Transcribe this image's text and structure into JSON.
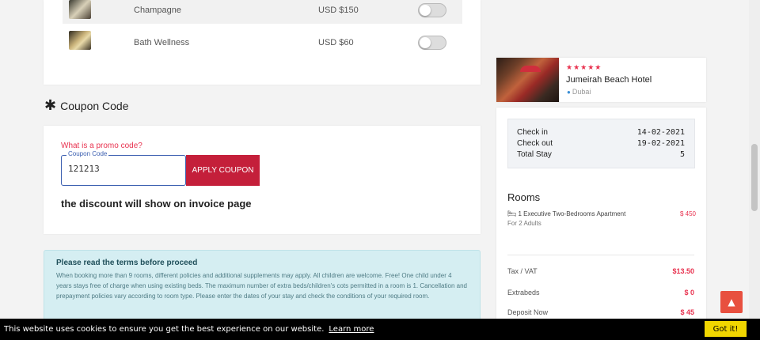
{
  "extras": [
    {
      "name": "Champagne",
      "price": "USD $150"
    },
    {
      "name": "Bath Wellness",
      "price": "USD $60"
    }
  ],
  "coupon": {
    "heading": "Coupon Code",
    "promo_link": "What is a promo code?",
    "field_label": "Coupon Code",
    "field_value": "121213",
    "apply_label": "APPLY COUPON",
    "discount_note": "the discount will show on invoice page"
  },
  "terms": {
    "title": "Please read the terms before proceed",
    "text": "When booking more than 9 rooms, different policies and additional supplements may apply. All children are welcome. Free! One child under 4 years stays free of charge when using existing beds. The maximum number of extra beds/children's cots permitted in a room is 1. Cancellation and prepayment policies vary according to room type. Please enter the dates of your stay and check the conditions of your required room."
  },
  "hotel": {
    "stars": "★★★★★",
    "name": "Jumeirah Beach Hotel",
    "location": "Dubai"
  },
  "stay": {
    "checkin_label": "Check in",
    "checkin_value": "14-02-2021",
    "checkout_label": "Check out",
    "checkout_value": "19-02-2021",
    "total_label": "Total Stay",
    "total_value": "5"
  },
  "rooms": {
    "heading": "Rooms",
    "room_name": "1 Executive Two-Bedrooms Apartment",
    "room_price": "$ 450",
    "room_sub": "For 2 Adults"
  },
  "fees": [
    {
      "label": "Tax / VAT",
      "value": "$13.50"
    },
    {
      "label": "Extrabeds",
      "value": "$ 0"
    },
    {
      "label": "Deposit Now",
      "value": "$ 45"
    }
  ],
  "cookie": {
    "message": "This website uses cookies to ensure you get the best experience on our website.",
    "learn_more": "Learn more",
    "button": "Got it!"
  },
  "colors": {
    "accent": "#c41f3a",
    "link": "#e8324f",
    "cookie_button": "#f1d600"
  }
}
